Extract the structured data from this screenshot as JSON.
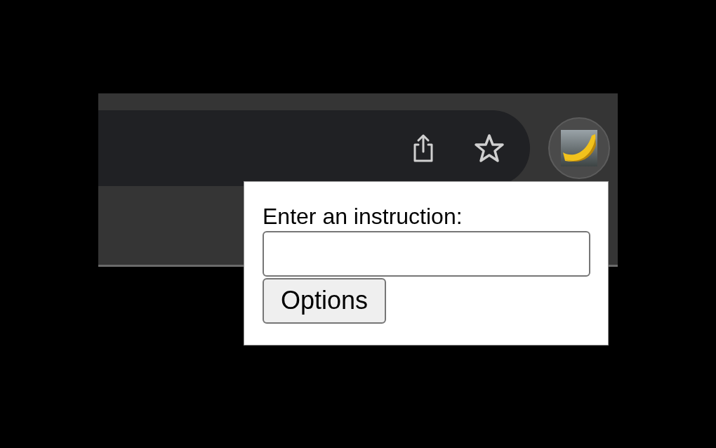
{
  "popup": {
    "label": "Enter an instruction:",
    "button": "Options"
  }
}
